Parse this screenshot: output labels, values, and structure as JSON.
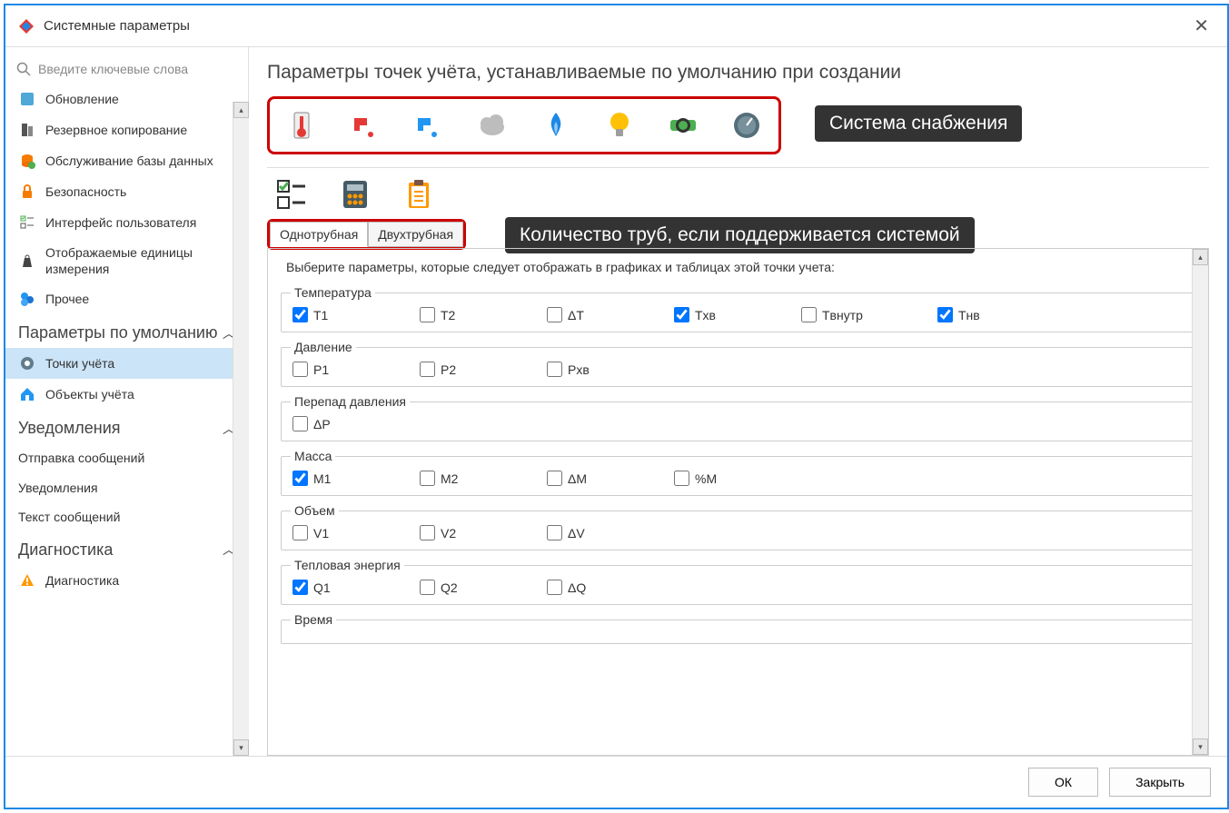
{
  "window": {
    "title": "Системные параметры"
  },
  "search": {
    "placeholder": "Введите ключевые слова"
  },
  "sidebar": {
    "items": [
      {
        "label": "Обновление"
      },
      {
        "label": "Резервное копирование"
      },
      {
        "label": "Обслуживание базы данных"
      },
      {
        "label": "Безопасность"
      },
      {
        "label": "Интерфейс пользователя"
      },
      {
        "label": "Отображаемые единицы измерения"
      },
      {
        "label": "Прочее"
      }
    ],
    "group_defaults": {
      "title": "Параметры по умолчанию",
      "items": [
        {
          "label": "Точки учёта"
        },
        {
          "label": "Объекты учёта"
        }
      ]
    },
    "group_notify": {
      "title": "Уведомления",
      "items": [
        {
          "label": "Отправка сообщений"
        },
        {
          "label": "Уведомления"
        },
        {
          "label": "Текст сообщений"
        }
      ]
    },
    "group_diag": {
      "title": "Диагностика",
      "items": [
        {
          "label": "Диагностика"
        }
      ]
    }
  },
  "main": {
    "title": "Параметры точек учёта, устанавливаемые по умолчанию при создании",
    "callout_supply": "Система снабжения",
    "callout_pipes": "Количество труб, если поддерживается системой",
    "tabs": [
      "Однотрубная",
      "Двухтрубная"
    ],
    "instruction": "Выберите параметры, которые следует отображать в графиках и таблицах этой точки учета:",
    "groups": {
      "temp": {
        "legend": "Температура",
        "items": [
          {
            "l": "T1",
            "c": true
          },
          {
            "l": "T2",
            "c": false
          },
          {
            "l": "ΔT",
            "c": false
          },
          {
            "l": "Tхв",
            "c": true
          },
          {
            "l": "Tвнутр",
            "c": false
          },
          {
            "l": "Tнв",
            "c": true
          }
        ]
      },
      "press": {
        "legend": "Давление",
        "items": [
          {
            "l": "P1",
            "c": false
          },
          {
            "l": "P2",
            "c": false
          },
          {
            "l": "Pхв",
            "c": false
          }
        ]
      },
      "dpress": {
        "legend": "Перепад давления",
        "items": [
          {
            "l": "ΔP",
            "c": false
          }
        ]
      },
      "mass": {
        "legend": "Масса",
        "items": [
          {
            "l": "M1",
            "c": true
          },
          {
            "l": "M2",
            "c": false
          },
          {
            "l": "ΔM",
            "c": false
          },
          {
            "l": "%M",
            "c": false
          }
        ]
      },
      "vol": {
        "legend": "Объем",
        "items": [
          {
            "l": "V1",
            "c": false
          },
          {
            "l": "V2",
            "c": false
          },
          {
            "l": "ΔV",
            "c": false
          }
        ]
      },
      "heat": {
        "legend": "Тепловая энергия",
        "items": [
          {
            "l": "Q1",
            "c": true
          },
          {
            "l": "Q2",
            "c": false
          },
          {
            "l": "ΔQ",
            "c": false
          }
        ]
      },
      "time": {
        "legend": "Время"
      }
    }
  },
  "footer": {
    "ok": "ОК",
    "close": "Закрыть"
  }
}
